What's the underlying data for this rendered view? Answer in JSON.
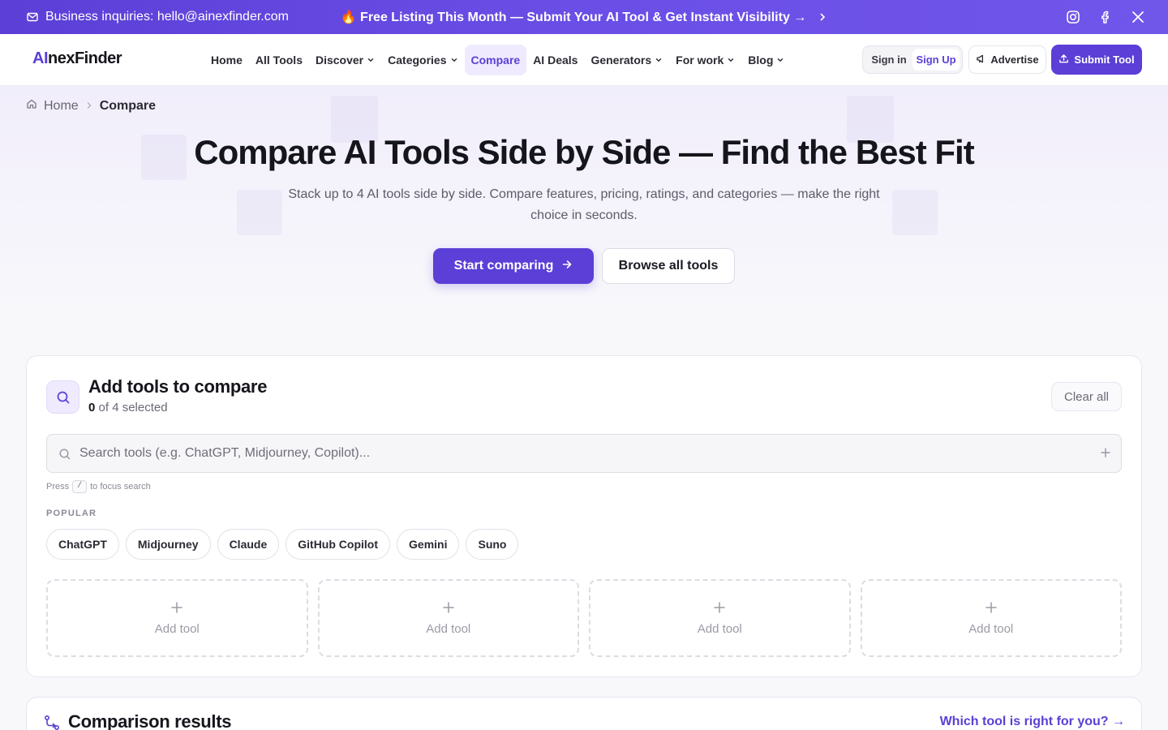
{
  "topbar": {
    "inquiry_text": "Business inquiries: hello@ainexfinder.com",
    "promo_text": "🔥 Free Listing This Month — Submit Your AI Tool & Get Instant Visibility →",
    "social_icons": [
      "instagram-icon",
      "facebook-icon",
      "x-icon"
    ]
  },
  "header": {
    "logo_ai": "AI",
    "logo_rest": "nexFinder",
    "nav": [
      {
        "label": "Home",
        "dropdown": false,
        "active": false
      },
      {
        "label": "All Tools",
        "dropdown": false,
        "active": false
      },
      {
        "label": "Discover",
        "dropdown": true,
        "active": false
      },
      {
        "label": "Categories",
        "dropdown": true,
        "active": false
      },
      {
        "label": "Compare",
        "dropdown": false,
        "active": true
      },
      {
        "label": "AI Deals",
        "dropdown": false,
        "active": false
      },
      {
        "label": "Generators",
        "dropdown": true,
        "active": false
      },
      {
        "label": "For work",
        "dropdown": true,
        "active": false
      },
      {
        "label": "Blog",
        "dropdown": true,
        "active": false
      }
    ],
    "sign_in": "Sign in",
    "sign_up": "Sign Up",
    "advertise": "Advertise",
    "submit_tool": "Submit Tool"
  },
  "hero": {
    "breadcrumb_home": "Home",
    "breadcrumb_current": "Compare",
    "title": "Compare AI Tools Side by Side — Find the Best Fit",
    "subtitle": "Stack up to 4 AI tools side by side. Compare features, pricing, ratings, and categories — make the right choice in seconds.",
    "primary_cta": "Start comparing",
    "secondary_cta": "Browse all tools"
  },
  "compare": {
    "title": "Add tools to compare",
    "selected_count": "0",
    "selected_suffix": "of 4 selected",
    "clear_all": "Clear all",
    "search_placeholder": "Search tools (e.g. ChatGPT, Midjourney, Copilot)...",
    "search_value": "",
    "hint_before": "Press",
    "hint_key": "/",
    "hint_after": "to focus search",
    "popular_label": "POPULAR",
    "popular": [
      "ChatGPT",
      "Midjourney",
      "Claude",
      "GitHub Copilot",
      "Gemini",
      "Suno"
    ],
    "slots": [
      "Add tool",
      "Add tool",
      "Add tool",
      "Add tool"
    ]
  },
  "results": {
    "title": "Comparison results",
    "link": "Which tool is right for you? →"
  },
  "colors": {
    "accent": "#5b3fd6",
    "accent_light": "#efeafd",
    "text": "#15151c"
  }
}
